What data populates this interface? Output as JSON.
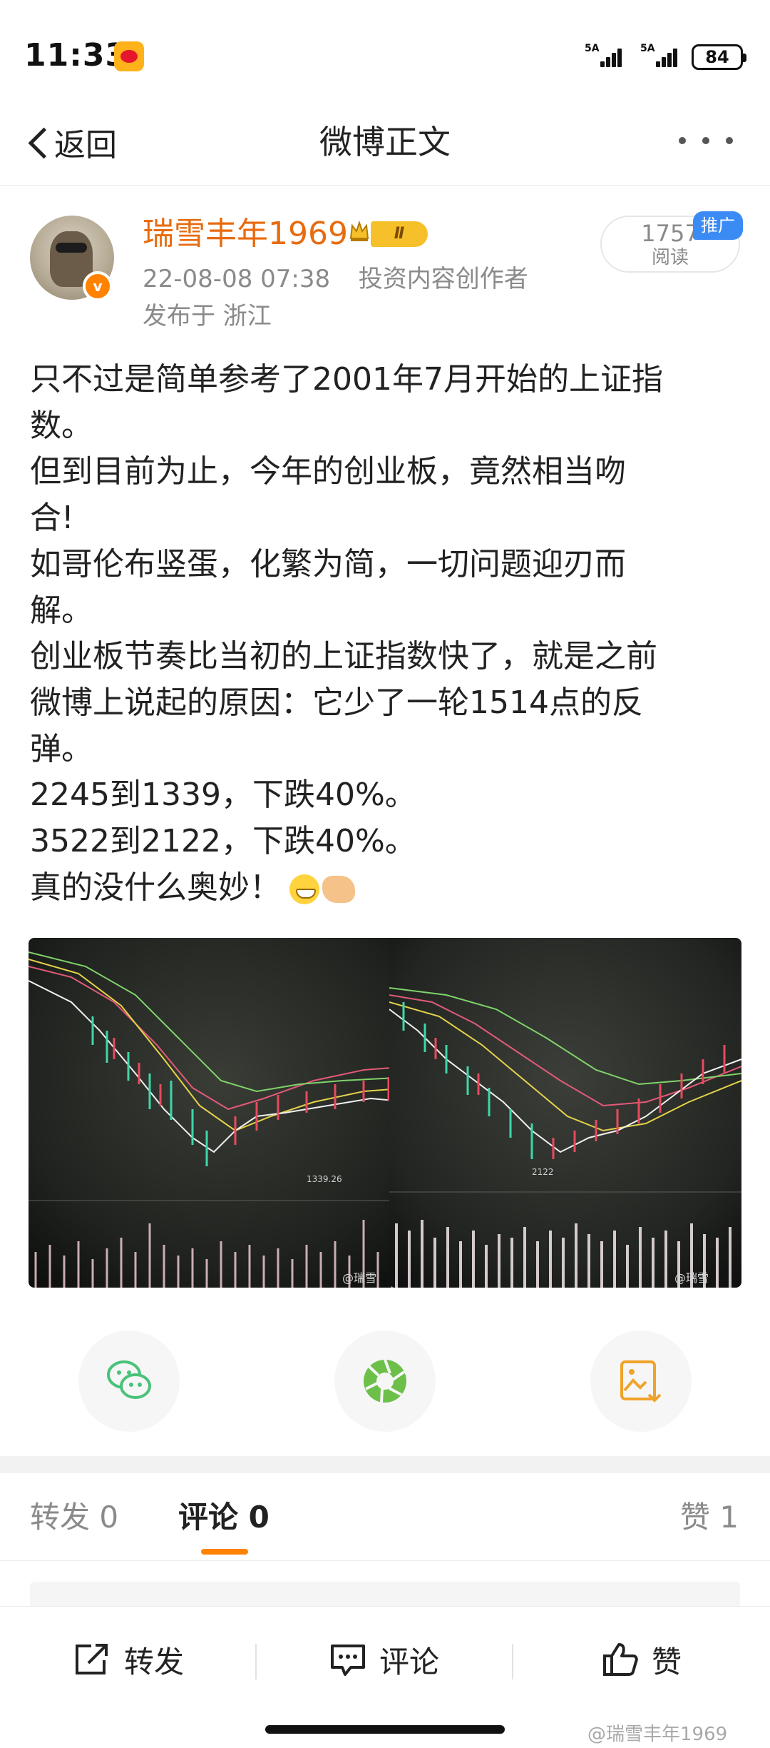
{
  "status_bar": {
    "time": "11:33",
    "signal1": "5A",
    "signal2": "5A",
    "battery": "84"
  },
  "nav": {
    "back_label": "返回",
    "title": "微博正文",
    "more_icon": "more-dots-icon"
  },
  "author": {
    "name": "瑞雪丰年1969",
    "level_badge": "Ⅱ",
    "verified_mark": "v",
    "timestamp": "22-08-08 07:38",
    "role": "投资内容创作者",
    "location": "发布于 浙江",
    "read_count": "1757",
    "read_label": "阅读",
    "promo_tag": "推广"
  },
  "post": {
    "lines": [
      "只不过是简单参考了2001年7月开始的上证指",
      "数。",
      "但到目前为止，今年的创业板，竟然相当吻",
      "合!",
      "如哥伦布竖蛋，化繁为简，一切问题迎刃而",
      "解。",
      "创业板节奏比当初的上证指数快了，就是之前",
      "微博上说起的原因：它少了一轮1514点的反",
      "弹。",
      "2245到1339，下跌40%。",
      "3522到2122，下跌40%。",
      "真的没什么奥妙！"
    ],
    "emoji": [
      "grin-emoji",
      "handshake-emoji"
    ]
  },
  "images": [
    {
      "name": "chart-photo-1",
      "low_label": "1339.26",
      "watermark": "@瑞雪"
    },
    {
      "name": "chart-photo-2",
      "low_label": "2122",
      "watermark": "@瑞雪"
    }
  ],
  "share": {
    "icons": [
      "wechat-icon",
      "moments-icon",
      "save-image-icon"
    ]
  },
  "tabs": {
    "repost": "转发 0",
    "comment": "评论 0",
    "like": "赞 1"
  },
  "bottom_bar": {
    "repost_label": "转发",
    "comment_label": "评论",
    "like_label": "赞",
    "watermark": "@瑞雪丰年1969"
  },
  "colors": {
    "accent": "#ff8200",
    "author_name": "#e86b0f",
    "promo_blue": "#3b8bf5",
    "wechat_green": "#4ac27a",
    "save_orange": "#f0a32a"
  }
}
